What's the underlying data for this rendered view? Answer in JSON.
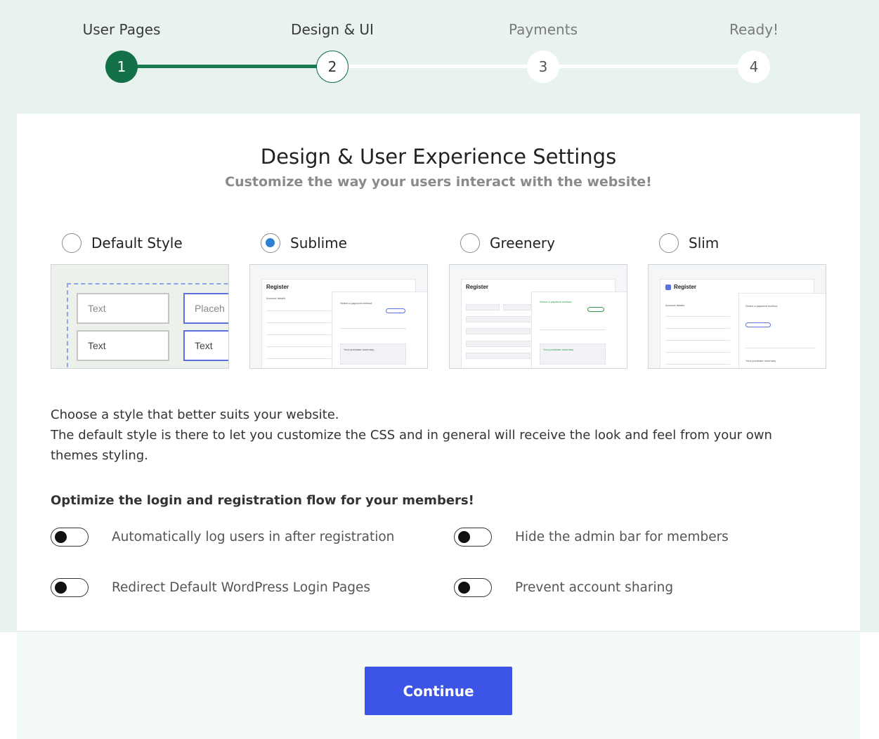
{
  "stepper": {
    "steps": [
      {
        "label": "User Pages",
        "number": "1",
        "state": "completed"
      },
      {
        "label": "Design & UI",
        "number": "2",
        "state": "current"
      },
      {
        "label": "Payments",
        "number": "3",
        "state": "upcoming"
      },
      {
        "label": "Ready!",
        "number": "4",
        "state": "upcoming"
      }
    ],
    "accent_color": "#137049"
  },
  "card": {
    "title": "Design & User Experience Settings",
    "subtitle": "Customize the way your users interact with the website!"
  },
  "styles": [
    {
      "label": "Default Style",
      "selected": false
    },
    {
      "label": "Sublime",
      "selected": true
    },
    {
      "label": "Greenery",
      "selected": false
    },
    {
      "label": "Slim",
      "selected": false
    }
  ],
  "default_preview": {
    "input1": "Text",
    "input2": "Placeh",
    "input3": "Text",
    "input4": "Text"
  },
  "mini_preview": {
    "register": "Register",
    "account_details": "Account details",
    "select_payment": "Select a payment method",
    "purchase_summary": "Your purchase summary"
  },
  "description": {
    "line1": "Choose a style that better suits your website.",
    "line2": "The default style is there to let you customize the CSS and in general will receive the look and feel from your own themes styling."
  },
  "options": {
    "heading": "Optimize the login and registration flow for your members!",
    "toggles": [
      {
        "label": "Automatically log users in after registration",
        "on": false
      },
      {
        "label": "Hide the admin bar for members",
        "on": false
      },
      {
        "label": "Redirect Default WordPress Login Pages",
        "on": false
      },
      {
        "label": "Prevent account sharing",
        "on": false
      }
    ]
  },
  "footer": {
    "continue_label": "Continue",
    "button_color": "#3c55e6"
  }
}
